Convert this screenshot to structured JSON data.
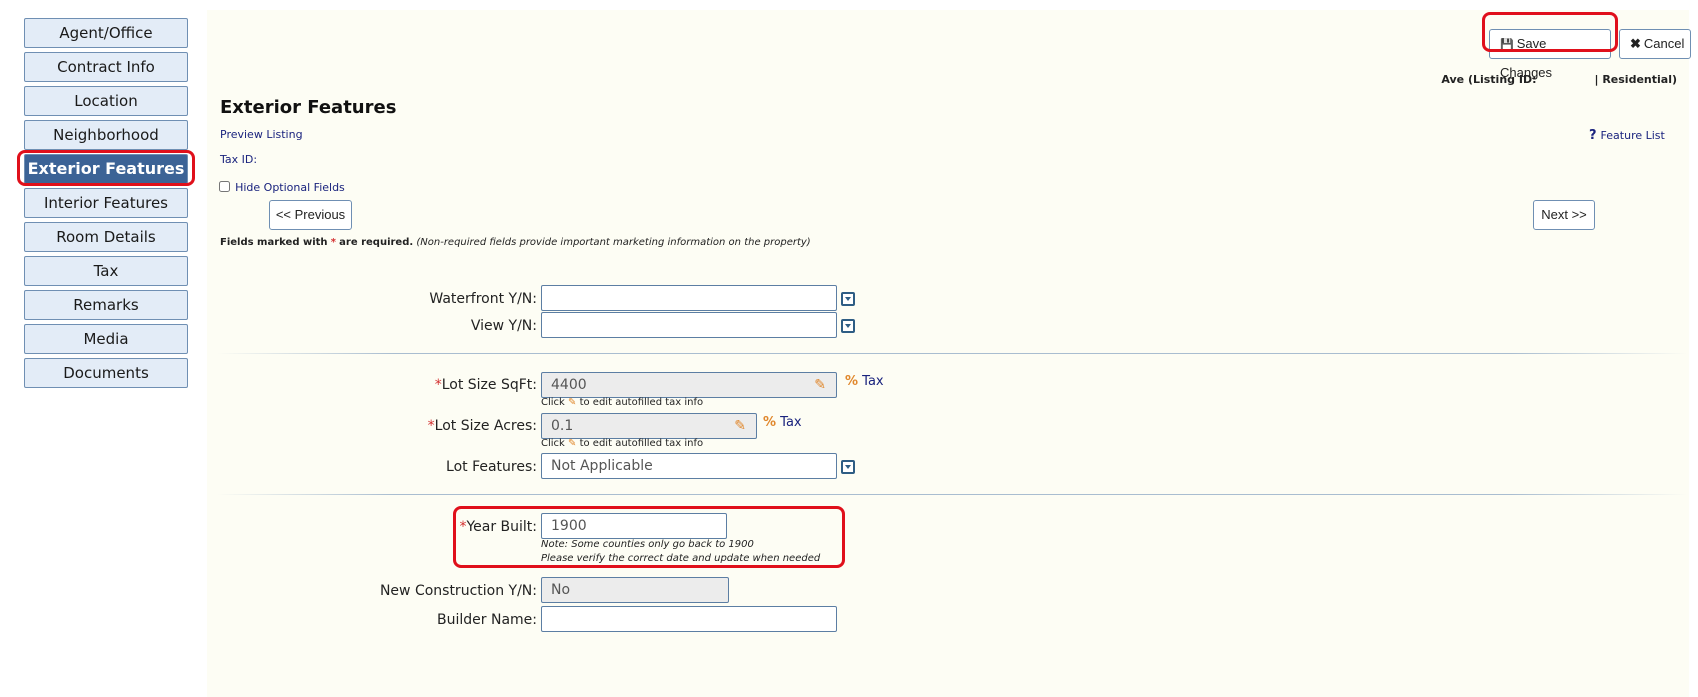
{
  "sidebar": {
    "items": [
      {
        "label": "Agent/Office"
      },
      {
        "label": "Contract Info"
      },
      {
        "label": "Location"
      },
      {
        "label": "Neighborhood"
      },
      {
        "label": "Exterior Features"
      },
      {
        "label": "Interior Features"
      },
      {
        "label": "Room Details"
      },
      {
        "label": "Tax"
      },
      {
        "label": "Remarks"
      },
      {
        "label": "Media"
      },
      {
        "label": "Documents"
      }
    ],
    "active_index": 4
  },
  "toolbar": {
    "save_label": "Save Changes",
    "cancel_label": "Cancel"
  },
  "listing": {
    "address_suffix": "Ave (Listing ID:",
    "type": "| Residential)"
  },
  "page": {
    "title": "Exterior Features",
    "preview_link": "Preview Listing",
    "feature_list_link": "Feature List",
    "tax_id_label": "Tax ID:",
    "hide_optional_label": "Hide Optional Fields",
    "prev_label": "<< Previous",
    "next_label": "Next >>",
    "required_note_bold": "Fields marked with",
    "required_note_star": "*",
    "required_note_bold2": "are required.",
    "required_note_italic": "(Non-required fields provide important marketing information on the property)"
  },
  "fields": {
    "waterfront": {
      "label": "Waterfront Y/N:",
      "value": ""
    },
    "view": {
      "label": "View Y/N:",
      "value": ""
    },
    "lot_sqft": {
      "label": "Lot Size SqFt:",
      "value": "4400",
      "tax_link": "Tax"
    },
    "lot_acres": {
      "label": "Lot Size Acres:",
      "value": "0.1",
      "tax_link": "Tax"
    },
    "autofill_hint_pre": "Click",
    "autofill_hint_post": "to edit autofilled tax info",
    "lot_features": {
      "label": "Lot Features:",
      "value": "Not Applicable"
    },
    "year_built": {
      "label": "Year Built:",
      "value": "1900",
      "note1": "Note: Some counties only go back to 1900",
      "note2": "Please verify the correct date and update when needed"
    },
    "new_construction": {
      "label": "New Construction Y/N:",
      "value": "No"
    },
    "builder_name": {
      "label": "Builder Name:",
      "value": ""
    }
  },
  "colors": {
    "accent": "#3c6396",
    "highlight": "#e0101b",
    "panel_bg": "#fdfdf4",
    "link": "#1a237e",
    "required": "#d32f2f"
  }
}
